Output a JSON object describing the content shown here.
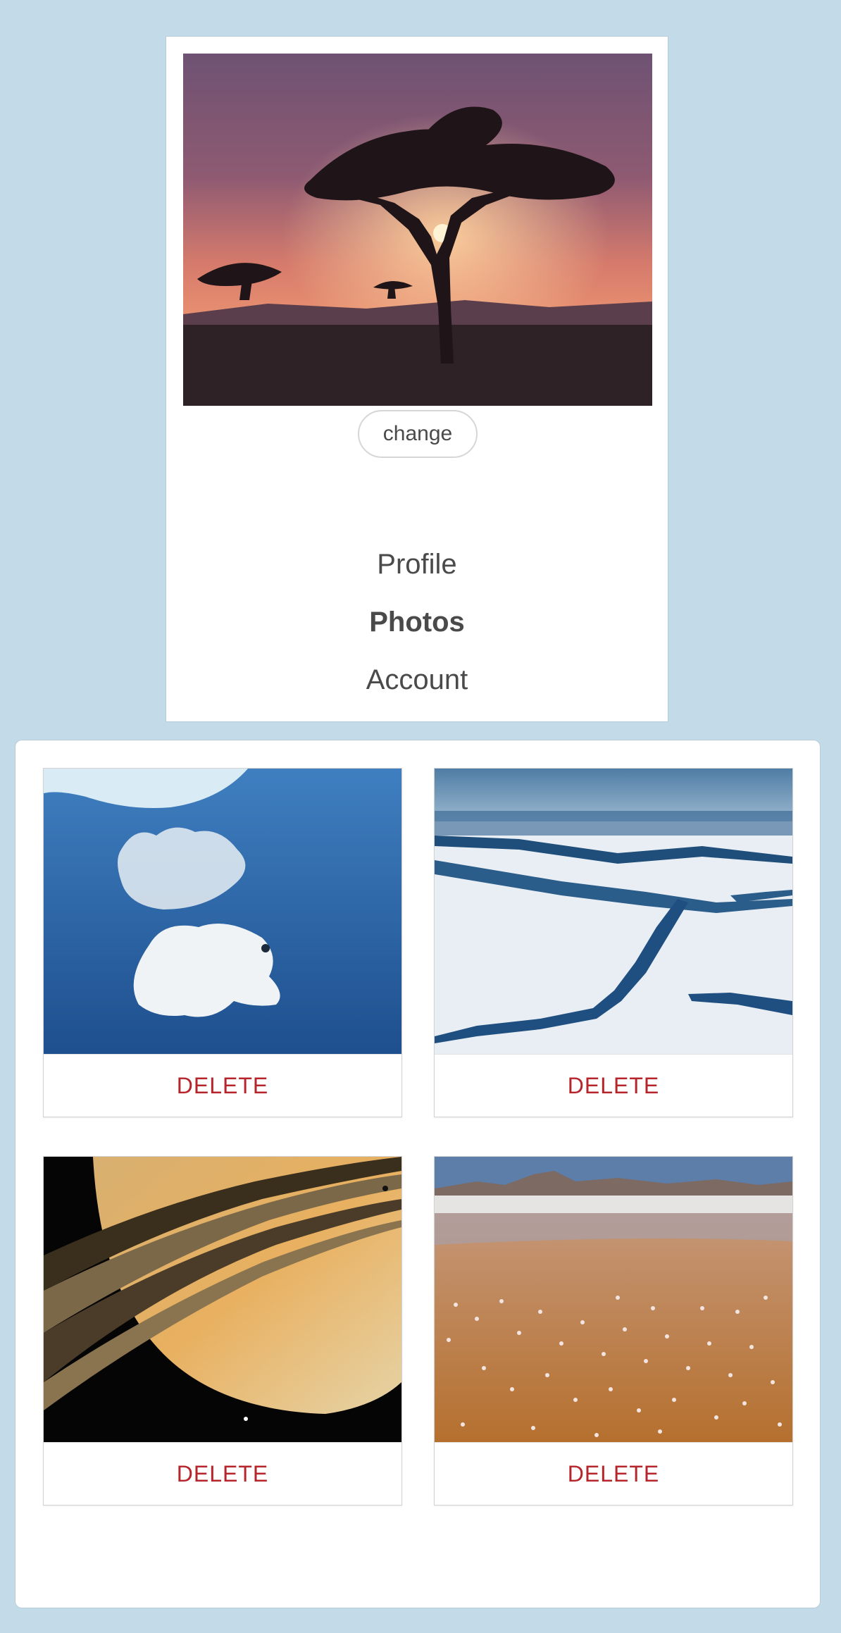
{
  "profile": {
    "cover_image": "acacia-tree-sunset-photo",
    "change_label": "change",
    "nav": {
      "items": [
        {
          "label": "Profile",
          "active": false
        },
        {
          "label": "Photos",
          "active": true
        },
        {
          "label": "Account",
          "active": false
        }
      ]
    }
  },
  "photos": {
    "items": [
      {
        "image": "polar-bear-underwater-photo",
        "delete_label": "DELETE"
      },
      {
        "image": "sea-ice-aerial-photo",
        "delete_label": "DELETE"
      },
      {
        "image": "saturn-rings-photo",
        "delete_label": "DELETE"
      },
      {
        "image": "flamingos-lake-photo",
        "delete_label": "DELETE"
      }
    ]
  },
  "colors": {
    "page_background": "#c3dbe9",
    "delete_text": "#b5252b",
    "nav_text": "#4a4a4a"
  }
}
